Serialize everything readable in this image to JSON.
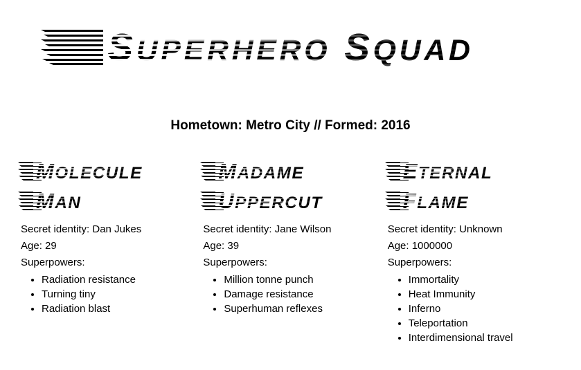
{
  "page": {
    "title": "Superhero Squad",
    "subtitle": "Hometown: Metro City // Formed: 2016",
    "background_color": "#ffffff",
    "text_color": "#000000"
  },
  "heroes": [
    {
      "name": "Molecule Man",
      "name_line1": "Molecule",
      "name_line2": "Man",
      "secret_identity_label": "Secret identity: Dan Jukes",
      "age_label": "Age: 29",
      "powers_label": "Superpowers:",
      "powers": [
        "Radiation resistance",
        "Turning tiny",
        "Radiation blast"
      ]
    },
    {
      "name": "Madame Uppercut",
      "name_line1": "Madame",
      "name_line2": "Uppercut",
      "secret_identity_label": "Secret identity: Jane Wilson",
      "age_label": "Age: 39",
      "powers_label": "Superpowers:",
      "powers": [
        "Million tonne punch",
        "Damage resistance",
        "Superhuman reflexes"
      ]
    },
    {
      "name": "Eternal Flame",
      "name_line1": "Eternal",
      "name_line2": "Flame",
      "secret_identity_label": "Secret identity: Unknown",
      "age_label": "Age: 1000000",
      "powers_label": "Superpowers:",
      "powers": [
        "Immortality",
        "Heat Immunity",
        "Inferno",
        "Teleportation",
        "Interdimensional travel"
      ]
    }
  ]
}
